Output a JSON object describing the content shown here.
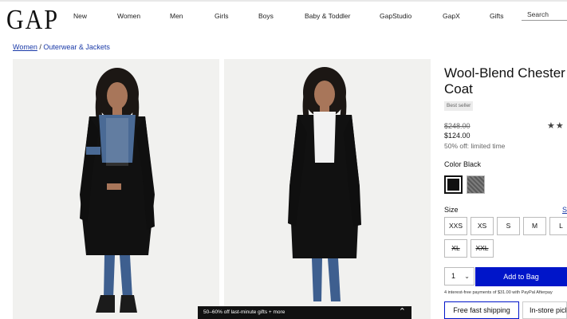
{
  "brand": {
    "logo_text": "GAP"
  },
  "nav": {
    "items": [
      {
        "label": "New"
      },
      {
        "label": "Women"
      },
      {
        "label": "Men"
      },
      {
        "label": "Girls"
      },
      {
        "label": "Boys"
      },
      {
        "label": "Baby & Toddler"
      },
      {
        "label": "GapStudio"
      },
      {
        "label": "GapX"
      },
      {
        "label": "Gifts"
      }
    ],
    "search_label": "Search"
  },
  "breadcrumb": {
    "level1": "Women",
    "separator": " / ",
    "level2": "Outerwear & Jackets"
  },
  "product": {
    "title_line1": "Wool-Blend Chester",
    "title_line2": "Coat",
    "badge": "Best seller",
    "stars": "★★",
    "original_price": "$248.00",
    "sale_price": "$124.00",
    "discount": "50% off: limited time",
    "color_label": "Color Black",
    "size_label": "Size",
    "size_guide": "S",
    "sizes": [
      "XXS",
      "XS",
      "S",
      "M",
      "L",
      "XL",
      "XXL"
    ],
    "quantity": "1",
    "add_to_bag": "Add to Bag",
    "installments": "4 interest-free payments of $31.00 with  PayPal    Afterpay",
    "ship_fast": "Free fast shipping",
    "ship_store": "In-store pick"
  },
  "promo": {
    "text": "50–60% off last-minute gifts + more"
  },
  "colors": {
    "accent": "#0015c9",
    "link": "#1a3aa8"
  },
  "icons": {
    "qty_chevron": "chevron-down-icon",
    "promo_caret": "chevron-up-icon"
  }
}
